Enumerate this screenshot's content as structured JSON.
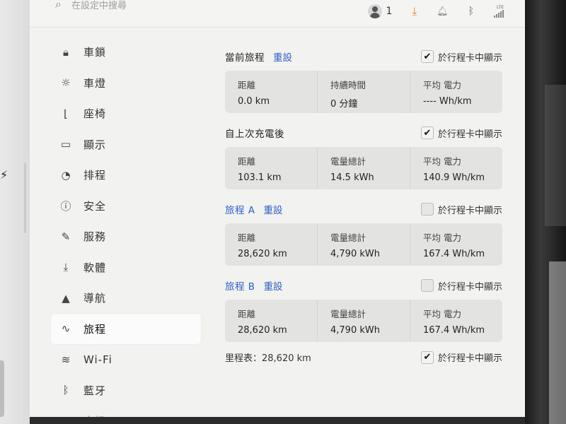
{
  "search": {
    "placeholder": "在設定中搜尋"
  },
  "status": {
    "profile_count": "1",
    "signal_label": "LTE"
  },
  "icons": {
    "search": "search-icon",
    "profile": "profile-icon",
    "download": "download-icon",
    "bell": "bell-icon",
    "bluetooth": "bluetooth-icon",
    "signal": "signal-icon"
  },
  "colors": {
    "accent_blue": "#2d5ec6",
    "download_orange": "#e87c1e",
    "screen_bg": "#f2f2f1",
    "card_bg": "#e3e3e2"
  },
  "sidebar": {
    "items": [
      {
        "label": "車鎖",
        "icon": "lock-icon",
        "glyph": "🔒︎"
      },
      {
        "label": "車燈",
        "icon": "light-icon",
        "glyph": "☼"
      },
      {
        "label": "座椅",
        "icon": "seat-icon",
        "glyph": "⌊"
      },
      {
        "label": "顯示",
        "icon": "display-icon",
        "glyph": "▭"
      },
      {
        "label": "排程",
        "icon": "schedule-icon",
        "glyph": "◔"
      },
      {
        "label": "安全",
        "icon": "safety-icon",
        "glyph": "ⓘ"
      },
      {
        "label": "服務",
        "icon": "wrench-icon",
        "glyph": "✎"
      },
      {
        "label": "軟體",
        "icon": "software-download-icon",
        "glyph": "⤓"
      },
      {
        "label": "導航",
        "icon": "navigation-icon",
        "glyph": "▲"
      },
      {
        "label": "旅程",
        "icon": "trips-icon",
        "glyph": "∿"
      },
      {
        "label": "Wi-Fi",
        "icon": "wifi-icon",
        "glyph": "≋"
      },
      {
        "label": "藍牙",
        "icon": "bluetooth-icon",
        "glyph": "ᛒ"
      },
      {
        "label": "音訊",
        "icon": "audio-icon",
        "glyph": "⫶"
      }
    ],
    "active_index": 9
  },
  "current_trip": {
    "title": "當前旅程",
    "reset": "重設",
    "checkbox_label": "於行程卡中顯示",
    "checked": true,
    "stats": [
      {
        "label": "距離",
        "value": "0.0 km"
      },
      {
        "label": "持續時間",
        "value": "0 分鐘"
      },
      {
        "label": "平均 電力",
        "value": "---- Wh/km"
      }
    ]
  },
  "since_charge": {
    "title": "自上次充電後",
    "checkbox_label": "於行程卡中顯示",
    "checked": true,
    "stats": [
      {
        "label": "距離",
        "value": "103.1 km"
      },
      {
        "label": "電量總計",
        "value": "14.5 kWh"
      },
      {
        "label": "平均 電力",
        "value": "140.9 Wh/km"
      }
    ]
  },
  "trip_a": {
    "title": "旅程 A",
    "reset": "重設",
    "checkbox_label": "於行程卡中顯示",
    "checked": false,
    "stats": [
      {
        "label": "距離",
        "value": "28,620 km"
      },
      {
        "label": "電量總計",
        "value": "4,790 kWh"
      },
      {
        "label": "平均 電力",
        "value": "167.4 Wh/km"
      }
    ]
  },
  "trip_b": {
    "title": "旅程 B",
    "reset": "重設",
    "checkbox_label": "於行程卡中顯示",
    "checked": false,
    "stats": [
      {
        "label": "距離",
        "value": "28,620 km"
      },
      {
        "label": "電量總計",
        "value": "4,790 kWh"
      },
      {
        "label": "平均 電力",
        "value": "167.4 Wh/km"
      }
    ]
  },
  "odometer": {
    "text": "里程表：28,620 km",
    "checkbox_label": "於行程卡中顯示",
    "checked": true
  }
}
